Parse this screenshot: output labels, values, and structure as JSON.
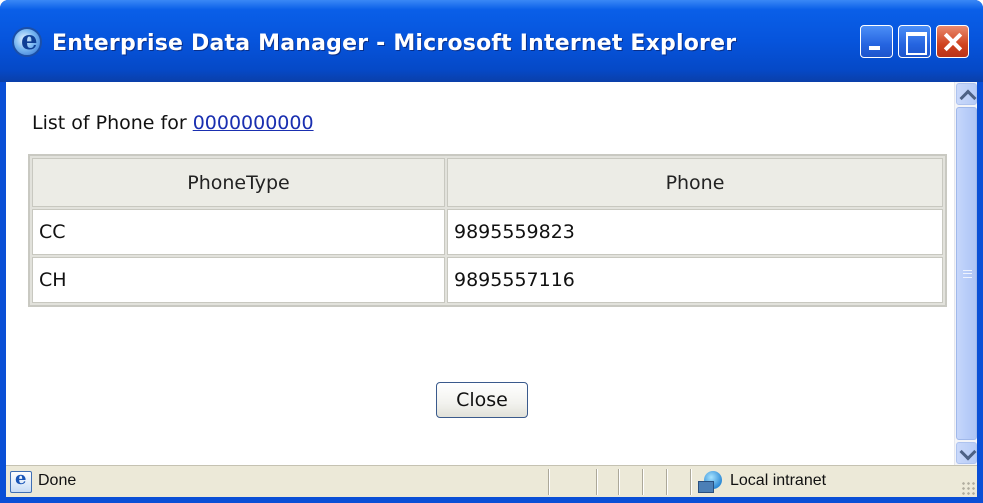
{
  "window": {
    "title": "Enterprise Data Manager - Microsoft Internet Explorer",
    "icon": "ie-icon",
    "controls": [
      "minimize-icon",
      "maximize-icon",
      "close-icon"
    ]
  },
  "page": {
    "caption_prefix": "List of Phone for",
    "caption_link": "0000000000",
    "table": {
      "headers": [
        "PhoneType",
        "Phone"
      ],
      "rows": [
        [
          "CC",
          "9895559823"
        ],
        [
          "CH",
          "9895557116"
        ]
      ]
    },
    "close_label": "Close"
  },
  "statusbar": {
    "status": "Done",
    "zone": "Local intranet"
  },
  "colors": {
    "titlebar": "#0654dc",
    "link": "#1a2fb0",
    "statusbar": "#ece9d8"
  }
}
